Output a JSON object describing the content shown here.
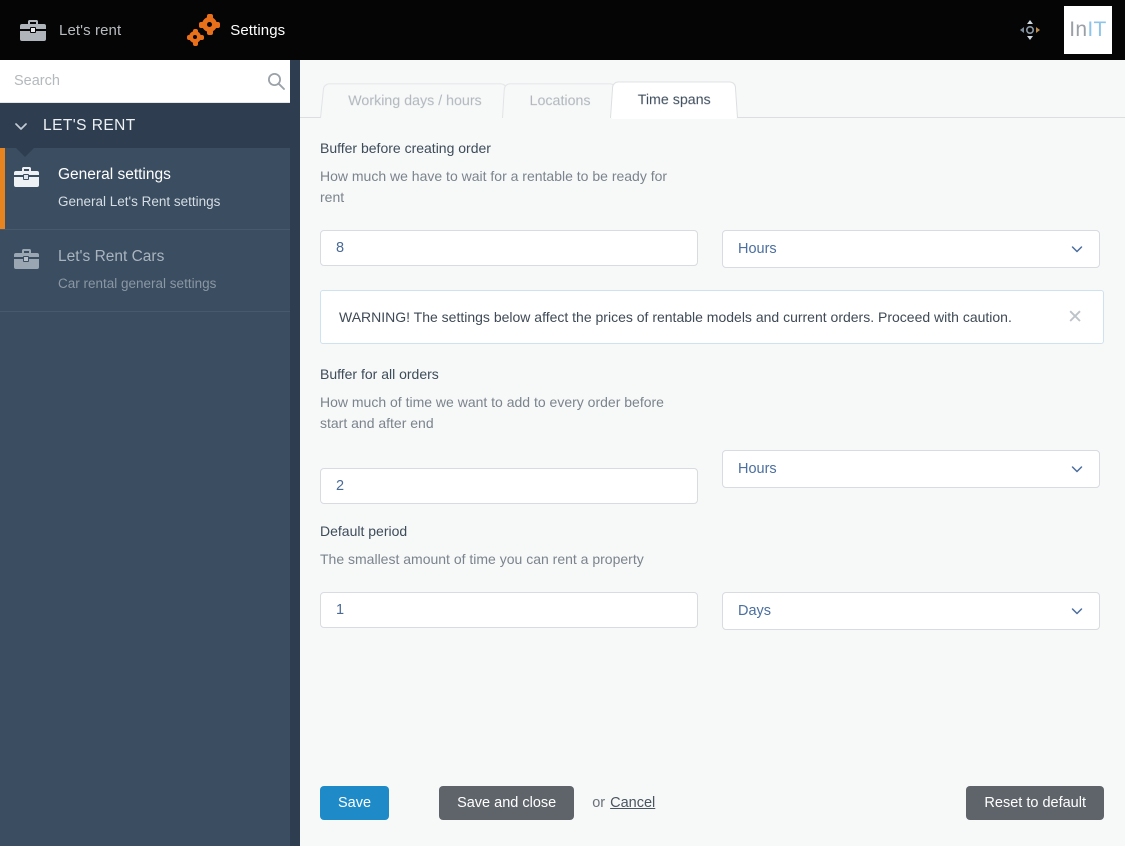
{
  "topbar": {
    "items": [
      {
        "label": "Let's rent",
        "icon": "briefcase-icon",
        "active": false
      },
      {
        "label": "Settings",
        "icon": "gears-icon",
        "active": true
      }
    ],
    "move_icon": "move-arrows-icon",
    "logo": {
      "part_a": "In",
      "part_b": "IT"
    }
  },
  "sidebar": {
    "search": {
      "value": "",
      "placeholder": "Search",
      "icon": "search-icon"
    },
    "section": {
      "label": "LET'S RENT",
      "icon": "chevron-down-icon"
    },
    "items": [
      {
        "title": "General settings",
        "subtitle": "General Let's Rent settings",
        "icon": "briefcase-icon",
        "active": true
      },
      {
        "title": "Let's Rent Cars",
        "subtitle": "Car rental general settings",
        "icon": "briefcase-icon",
        "active": false
      }
    ]
  },
  "tabs": [
    {
      "label": "Working days / hours",
      "active": false
    },
    {
      "label": "Locations",
      "active": false
    },
    {
      "label": "Time spans",
      "active": true
    }
  ],
  "form": {
    "fields": [
      {
        "label": "Buffer before creating order",
        "description": "How much we have to wait for a rentable to be ready for rent",
        "value": "8",
        "unit": "Hours"
      },
      {
        "label": "Buffer for all orders",
        "description": "How much of time we want to add to every order before start and after end",
        "value": "2",
        "unit": "Hours"
      },
      {
        "label": "Default period",
        "description": "The smallest amount of time you can rent a property",
        "value": "1",
        "unit": "Days"
      }
    ],
    "warning": {
      "text": "WARNING! The settings below affect the prices of rentable models and current orders. Proceed with caution.",
      "close": "✕"
    }
  },
  "footer": {
    "save_label": "Save",
    "save_close_label": "Save and close",
    "or_label": "or",
    "cancel_label": "Cancel",
    "reset_label": "Reset to default"
  },
  "colors": {
    "topbar_bg": "#050505",
    "sidebar_bg": "#3a4d61",
    "sidebar_header_bg": "#2e3e50",
    "accent_orange": "#e8841f",
    "primary_blue": "#1e8bc8",
    "grey_button": "#5f646b"
  }
}
